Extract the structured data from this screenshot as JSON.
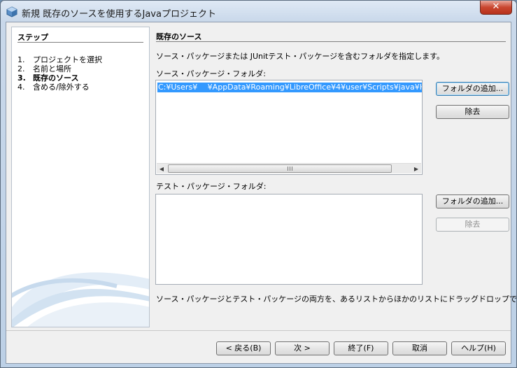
{
  "window": {
    "title": "新規 既存のソースを使用するJavaプロジェクト",
    "close_glyph": "✕"
  },
  "steps": {
    "heading": "ステップ",
    "items": [
      {
        "num": "1.",
        "label": "プロジェクトを選択"
      },
      {
        "num": "2.",
        "label": "名前と場所"
      },
      {
        "num": "3.",
        "label": "既存のソース"
      },
      {
        "num": "4.",
        "label": "含める/除外する"
      }
    ],
    "current_index": 2
  },
  "main": {
    "heading": "既存のソース",
    "description": "ソース・パッケージまたは JUnitテスト・パッケージを含むフォルダを指定します。",
    "source_folders": {
      "label": "ソース・パッケージ・フォルダ:",
      "items": [
        "C:¥Users¥　 ¥AppData¥Roaming¥LibreOffice¥4¥user¥Scripts¥java¥Hello"
      ],
      "add_button": "フォルダの追加...",
      "remove_button": "除去"
    },
    "test_folders": {
      "label": "テスト・パッケージ・フォルダ:",
      "items": [],
      "add_button": "フォルダの追加...",
      "remove_button": "除去"
    },
    "note": "ソース・パッケージとテスト・パッケージの両方を、あるリストからほかのリストにドラッグドロップできます。"
  },
  "footer": {
    "back": "< 戻る(B)",
    "next": "次 >",
    "finish": "終了(F)",
    "cancel": "取消",
    "help": "ヘルプ(H)"
  },
  "scrollbar": {
    "left_arrow": "◀",
    "right_arrow": "▶"
  }
}
